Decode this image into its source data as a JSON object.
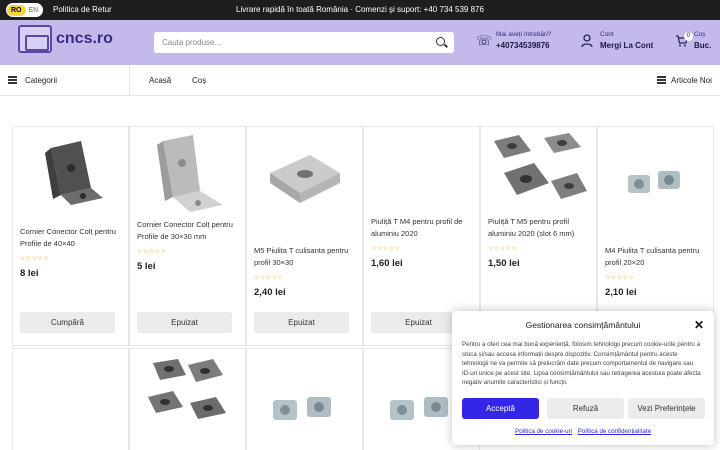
{
  "topbar": {
    "lang_active": "RO",
    "lang_other": "EN",
    "return_policy": "Politica de Retur",
    "message": "Livrare rapidă în toată România · Comenzi și suport: +40 734 539 876"
  },
  "header": {
    "logo_text": "cncs.ro",
    "search_placeholder": "Cauta produse...",
    "contact_label": "Mai aveți întrebări?",
    "contact_phone": "+40734539876",
    "account_label": "Cont",
    "account_link": "Mergi La Cont",
    "cart_label": "Coș",
    "cart_value": "Buc.",
    "cart_count": "0"
  },
  "nav": {
    "categories": "Categorii",
    "home": "Acasă",
    "cart": "Coș",
    "new_articles": "Articole Noi"
  },
  "products": [
    {
      "title": "Cornier Conector Colț pentru Profile de 40×40",
      "price": "8 lei",
      "button": "Cumpără"
    },
    {
      "title": "Cornier Conector Colț pentru Profile de 30×30 mm",
      "price": "5 lei",
      "button": "Epuizat"
    },
    {
      "title": "M5 Piulita T culisanta pentru profil 30×30",
      "price": "2,40 lei",
      "button": "Epuizat"
    },
    {
      "title": "Piuliță T M4 pentru profil de aluminiu 2020",
      "price": "1,60 lei",
      "button": "Epuizat"
    },
    {
      "title": "Piuliță T M5 pentru profil aluminiu 2020 (slot 6 mm)",
      "price": "1,50 lei",
      "button": ""
    },
    {
      "title": "M4 Piulita T culisanta pentru profil 20×20",
      "price": "2,10 lei",
      "button": ""
    }
  ],
  "cookie": {
    "title": "Gestionarea consimțământului",
    "body": "Pentru a oferi cea mai bună experiență, folosim tehnologii precum cookie-urile pentru a stoca și/sau accesa informații despre dispozitiv. Consimțământul pentru aceste tehnologii ne va permite să prelucrăm date precum comportamentul de navigare sau ID-uri unice pe acest site. Lipsa consimțământului sau retragerea acestuia poate afecta negativ anumite caracteristici și funcții.",
    "accept": "Acceptă",
    "deny": "Refuză",
    "preferences": "Vezi Preferințele",
    "cookie_policy": "Politica de cookie-uri",
    "privacy_policy": "Politica de confidențialitate"
  },
  "icons": {
    "phone": "phone-icon",
    "user": "user-icon",
    "cart": "cart-icon",
    "search": "search-icon",
    "menu": "menu-icon",
    "close": "close-icon"
  },
  "colors": {
    "header_bg": "#c5b9ec",
    "topbar_bg": "#1e1e1e",
    "accept_btn": "#3426e8",
    "stars": "#e0a800"
  }
}
